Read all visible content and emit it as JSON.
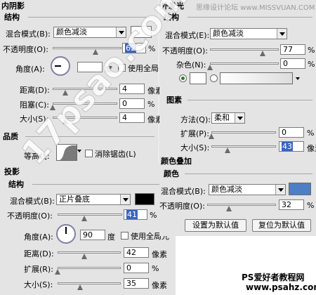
{
  "inner_shadow": {
    "title": "内阴影",
    "section": "结构",
    "blend_label": "混合模式(B):",
    "blend_value": "颜色减淡",
    "opacity_label": "不透明度(O):",
    "opacity_value": "62",
    "opacity_unit": "%",
    "angle_label": "角度(A):",
    "angle_unit": "度",
    "global_light": "使用全局",
    "distance_label": "距离(D):",
    "distance_value": "4",
    "distance_unit": "像素",
    "choke_label": "阻塞(C):",
    "choke_value": "0",
    "choke_unit": "%",
    "size_label": "大小(S):",
    "size_value": "4",
    "size_unit": "像素"
  },
  "quality": {
    "title": "品质",
    "contour_label": "等高线:",
    "antialias": "消除锯齿(L)"
  },
  "drop_shadow": {
    "title": "投影",
    "section": "结构",
    "blend_label": "混合模式(B):",
    "blend_value": "正片叠底",
    "opacity_label": "不透明度(O):",
    "opacity_value": "41",
    "opacity_unit": "%",
    "angle_label": "角度(A):",
    "angle_value": "90",
    "angle_unit": "度",
    "global_light": "使用全局光",
    "distance_label": "距离(D):",
    "distance_value": "42",
    "distance_unit": "像素",
    "spread_label": "扩展(R):",
    "spread_value": "0",
    "spread_unit": "%",
    "size_label": "大小(S):",
    "size_value": "35",
    "size_unit": "像素"
  },
  "outer_glow": {
    "title": "外发光",
    "section": "结构",
    "blend_label": "混合模式(E):",
    "blend_value": "颜色减淡",
    "opacity_label": "不透明度(O):",
    "opacity_value": "77",
    "opacity_unit": "%",
    "noise_label": "杂色(N):",
    "noise_value": "0",
    "noise_unit": "%"
  },
  "elements": {
    "title": "图素",
    "technique_label": "方法(Q):",
    "technique_value": "柔和",
    "spread_label": "扩展(P):",
    "spread_value": "0",
    "spread_unit": "%",
    "size_label": "大小(S):",
    "size_value": "43",
    "size_unit": "像素"
  },
  "color_overlay": {
    "title": "颜色叠加",
    "section": "颜色",
    "blend_label": "混合模式(B):",
    "blend_value": "颜色减淡",
    "opacity_label": "不透明度(O):",
    "opacity_value": "32",
    "opacity_unit": "%",
    "btn_default": "设置为默认值",
    "btn_reset": "复位为默认值"
  },
  "watermarks": {
    "top_right": "思缘设计论坛 www.MISSVUAN.COM",
    "diagonal": "17psao.com",
    "bottom_right_1": "PS爱好者教程网",
    "bottom_right_2": "www.psahz.com"
  },
  "colors": {
    "overlay_swatch": "#4e7fc6",
    "selection": "#3a64c0",
    "drop_swatch": "#000000"
  },
  "sliders": {
    "inner_opacity": 0.62,
    "inner_distance": 0.2,
    "inner_choke": 0.0,
    "inner_size": 0.2,
    "drop_opacity": 0.41,
    "drop_distance": 0.42,
    "drop_spread": 0.0,
    "drop_size": 0.35,
    "glow_opacity": 0.77,
    "glow_noise": 0.0,
    "el_spread": 0.0,
    "el_size": 0.25,
    "ov_opacity": 0.32
  }
}
